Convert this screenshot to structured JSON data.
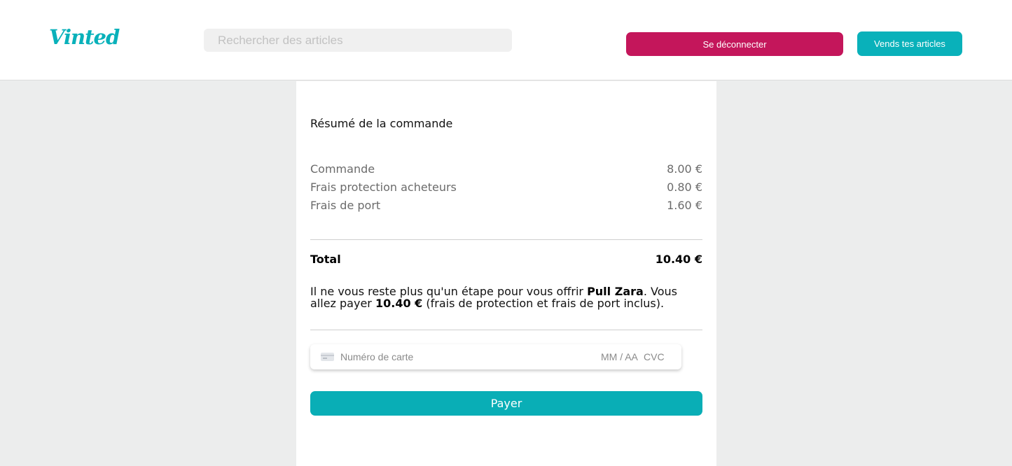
{
  "header": {
    "logo": "Vinted",
    "search_placeholder": "Rechercher des articles",
    "logout_label": "Se déconnecter",
    "sell_label": "Vends tes articles"
  },
  "summary": {
    "title": "Résumé de la commande",
    "lines": [
      {
        "label": "Commande",
        "amount": "8.00 €"
      },
      {
        "label": "Frais protection acheteurs",
        "amount": "0.80 €"
      },
      {
        "label": "Frais de port",
        "amount": "1.60 €"
      }
    ],
    "total_label": "Total",
    "total_amount": "10.40 €"
  },
  "message": {
    "part1": "Il ne vous reste plus qu'un étape pour vous offrir ",
    "item": "Pull Zara",
    "part2": ". Vous allez payer ",
    "amount": "10.40 €",
    "part3": " (frais de protection et frais de port inclus)."
  },
  "card": {
    "number_placeholder": "Numéro de carte",
    "expiry_placeholder": "MM / AA",
    "cvc_placeholder": "CVC",
    "icon": "credit-card-icon"
  },
  "pay_label": "Payer",
  "colors": {
    "brand": "#09b1ba",
    "logout": "#c4165b",
    "background": "#eceded"
  }
}
